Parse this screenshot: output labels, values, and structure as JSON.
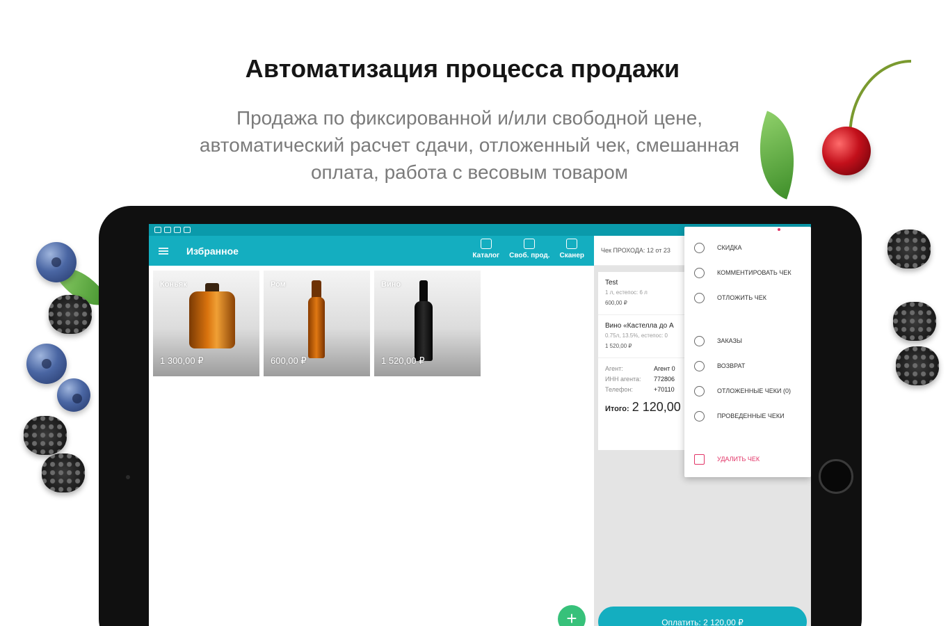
{
  "promo": {
    "headline": "Автоматизация процесса продажи",
    "subtext": "Продажа по фиксированной и/или свободной цене, автоматический расчет сдачи, отложенный чек, смешанная оплата, работа с весовым товаром"
  },
  "app_bar": {
    "title": "Избранное",
    "actions": [
      {
        "label": "Каталог",
        "icon": "catalog-icon"
      },
      {
        "label": "Своб. прод.",
        "icon": "free-sale-icon"
      },
      {
        "label": "Сканер",
        "icon": "scanner-icon"
      }
    ]
  },
  "products": [
    {
      "name": "Коньяк",
      "price": "1 300,00 ₽"
    },
    {
      "name": "Ром",
      "price": "600,00 ₽"
    },
    {
      "name": "Вино",
      "price": "1 520,00 ₽"
    }
  ],
  "receipt": {
    "header": "Чек ПРОХОДА: 12 от 23",
    "items": [
      {
        "title": "Test",
        "sub": "1 л, естепос: 6 л",
        "price": "600,00 ₽"
      },
      {
        "title": "Вино «Кастелла до А",
        "sub": "0.75л, 13.5%, естепос: 0",
        "price": "1 520,00 ₽"
      }
    ],
    "agent": [
      {
        "key": "Агент:",
        "value": "Агент 0"
      },
      {
        "key": "ИНН агента:",
        "value": "772806"
      },
      {
        "key": "Телефон:",
        "value": "+70110"
      }
    ],
    "total_label": "Итого:",
    "total_value": "2 120,00",
    "pay_button": "Оплатить: 2 120,00 ₽"
  },
  "menu": {
    "items": [
      {
        "label": "СКИДКА",
        "icon": "discount-icon"
      },
      {
        "label": "КОММЕНТИРОВАТЬ ЧЕК",
        "icon": "comment-icon"
      },
      {
        "label": "ОТЛОЖИТЬ ЧЕК",
        "icon": "postpone-icon"
      },
      {
        "label": "ЗАКАЗЫ",
        "icon": "globe-icon"
      },
      {
        "label": "ВОЗВРАТ",
        "icon": "return-icon"
      },
      {
        "label": "ОТЛОЖЕННЫЕ ЧЕКИ (0)",
        "icon": "postponed-list-icon"
      },
      {
        "label": "ПРОВЕДЕННЫЕ ЧЕКИ",
        "icon": "checked-icon"
      },
      {
        "label": "УДАЛИТЬ ЧЕК",
        "icon": "trash-icon"
      }
    ]
  },
  "fab": {
    "glyph": "+"
  },
  "colors": {
    "accent": "#14aec0",
    "status_bar": "#0a9aab",
    "danger": "#e23366",
    "fab": "#37c17a"
  }
}
